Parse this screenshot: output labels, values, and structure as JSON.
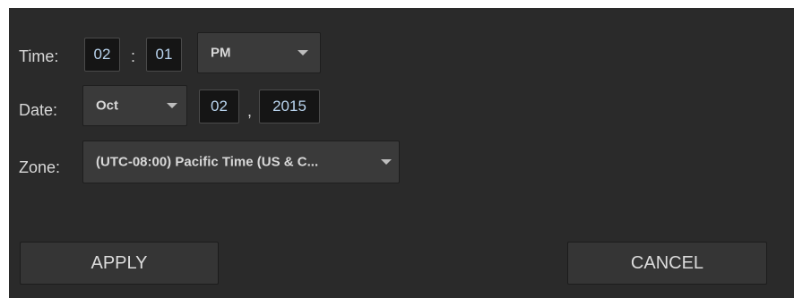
{
  "time": {
    "label": "Time:",
    "hour": "02",
    "separator": ":",
    "minute": "01",
    "ampm": "PM"
  },
  "date": {
    "label": "Date:",
    "month": "Oct",
    "day": "02",
    "separator": ",",
    "year": "2015"
  },
  "zone": {
    "label": "Zone:",
    "value": "(UTC-08:00) Pacific Time (US & C..."
  },
  "buttons": {
    "apply": "APPLY",
    "cancel": "CANCEL"
  },
  "icons": {
    "dropdown": "caret-down-icon"
  },
  "colors": {
    "panel_bg": "#2a2a2a",
    "field_bg": "#151515",
    "field_text": "#b9d4ee",
    "dropdown_bg": "#3a3a3a",
    "label_text": "#d8d8d8"
  }
}
